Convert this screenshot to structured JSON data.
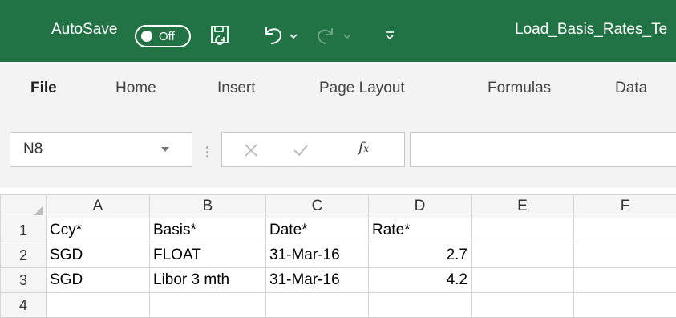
{
  "titlebar": {
    "autosave_label": "AutoSave",
    "autosave_state": "Off",
    "filename": "Load_Basis_Rates_Te"
  },
  "ribbon": {
    "tabs": [
      "File",
      "Home",
      "Insert",
      "Page Layout",
      "Formulas",
      "Data"
    ]
  },
  "formula_bar": {
    "name_box": "N8",
    "formula": ""
  },
  "grid": {
    "columns": [
      "A",
      "B",
      "C",
      "D",
      "E",
      "F"
    ],
    "rows": [
      {
        "num": "1",
        "cells": [
          "Ccy*",
          "Basis*",
          "Date*",
          "Rate*",
          "",
          ""
        ]
      },
      {
        "num": "2",
        "cells": [
          "SGD",
          "FLOAT",
          "31-Mar-16",
          "2.7",
          "",
          ""
        ]
      },
      {
        "num": "3",
        "cells": [
          "SGD",
          "Libor 3 mth",
          "31-Mar-16",
          "4.2",
          "",
          ""
        ]
      },
      {
        "num": "4",
        "cells": [
          "",
          "",
          "",
          "",
          "",
          ""
        ]
      }
    ]
  },
  "colors": {
    "title_bar": "#217346",
    "ribbon_bg": "#f3f3f3"
  }
}
